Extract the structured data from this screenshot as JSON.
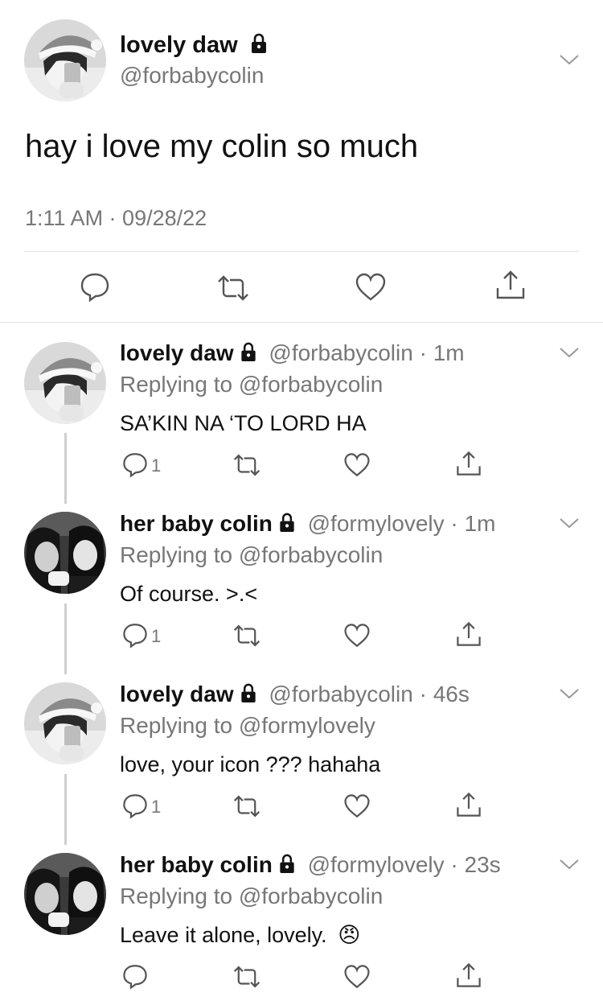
{
  "main_tweet": {
    "display_name": "lovely daw",
    "handle": "@forbabycolin",
    "text": "hay i love my colin so much",
    "timestamp": "1:11 AM · 09/28/22"
  },
  "replies": [
    {
      "display_name": "lovely daw",
      "handle": "@forbabycolin",
      "time": "· 1m",
      "replying_label": "Replying to",
      "replying_to": "@forbabycolin",
      "text": "SA’KIN NA ‘TO LORD HA",
      "reply_count": "1"
    },
    {
      "display_name": "her baby colin",
      "handle": "@formylovely",
      "time": "· 1m",
      "replying_label": "Replying to",
      "replying_to": "@forbabycolin",
      "text": "Of course. >.<",
      "reply_count": "1"
    },
    {
      "display_name": "lovely daw",
      "handle": "@forbabycolin",
      "time": "· 46s",
      "replying_label": "Replying to",
      "replying_to": "@formylovely",
      "text": "love, your icon ??? hahaha",
      "reply_count": "1"
    },
    {
      "display_name": "her baby colin",
      "handle": "@formylovely",
      "time": "· 23s",
      "replying_label": "Replying to",
      "replying_to": "@forbabycolin",
      "text": "Leave it alone, lovely.",
      "emoji": "😠",
      "reply_count": ""
    }
  ],
  "icons": [
    "chevron-down-icon",
    "lock-icon",
    "reply-icon",
    "retweet-icon",
    "like-icon",
    "share-icon"
  ],
  "colors": {
    "text": "#111111",
    "secondary": "#777777",
    "divider": "#e2e2e2",
    "thread_line": "#cfcfcf"
  }
}
